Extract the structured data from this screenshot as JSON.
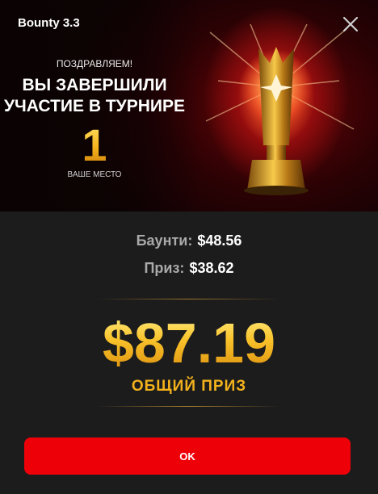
{
  "window": {
    "title": "Bounty 3.3"
  },
  "hero": {
    "congrats": "ПОЗДРАВЛЯЕМ!",
    "headline_line1": "ВЫ ЗАВЕРШИЛИ",
    "headline_line2": "УЧАСТИЕ В ТУРНИРЕ",
    "place": "1",
    "place_label": "ВАШЕ МЕСТО"
  },
  "results": {
    "bounty_label": "Баунти:",
    "bounty_value": "$48.56",
    "prize_label": "Приз:",
    "prize_value": "$38.62",
    "total_value": "$87.19",
    "total_label": "ОБЩИЙ ПРИЗ"
  },
  "actions": {
    "ok_label": "OK"
  },
  "colors": {
    "accent_red": "#ee0008",
    "gold": "#f3b21c",
    "background": "#1c1c1c"
  }
}
